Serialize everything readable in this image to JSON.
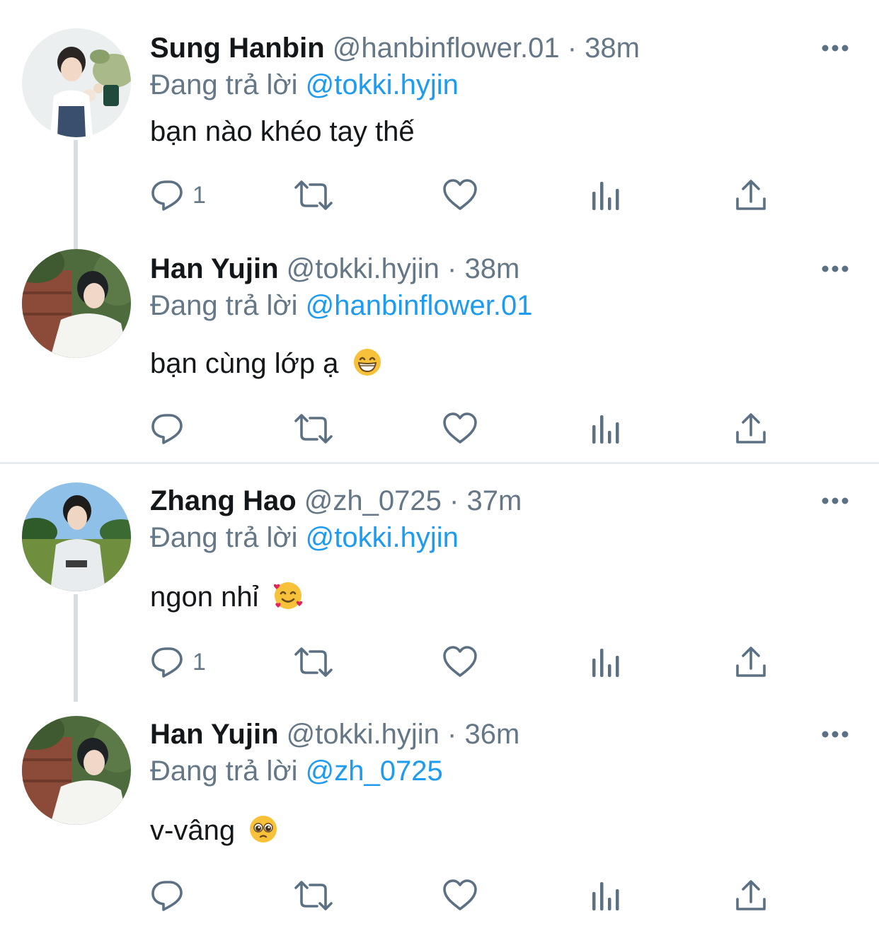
{
  "reply_label": "Đang trả lời",
  "tweets": [
    {
      "name": "Sung Hanbin",
      "handle": "@hanbinflower.01",
      "separator": "·",
      "time": "38m",
      "reply_to": "@tokki.hyjin",
      "text": "bạn nào khéo tay thế",
      "emoji": "",
      "reply_count": "1"
    },
    {
      "name": "Han Yujin",
      "handle": "@tokki.hyjin",
      "separator": "·",
      "time": "38m",
      "reply_to": "@hanbinflower.01",
      "text": "bạn cùng lớp ạ",
      "emoji": "grinning-face",
      "reply_count": ""
    },
    {
      "name": "Zhang Hao",
      "handle": "@zh_0725",
      "separator": "·",
      "time": "37m",
      "reply_to": "@tokki.hyjin",
      "text": "ngon nhỉ",
      "emoji": "smiling-face-with-hearts",
      "reply_count": "1"
    },
    {
      "name": "Han Yujin",
      "handle": "@tokki.hyjin",
      "separator": "·",
      "time": "36m",
      "reply_to": "@zh_0725",
      "text": "v-vâng",
      "emoji": "pleading-face",
      "reply_count": ""
    }
  ],
  "icons": [
    "reply-icon",
    "retweet-icon",
    "like-icon",
    "analytics-icon",
    "share-icon",
    "more-icon"
  ],
  "colors": {
    "mention": "#1d9bf0",
    "secondary_text": "#657786",
    "icon": "#5b7083",
    "thread_line": "#d7dde2"
  }
}
